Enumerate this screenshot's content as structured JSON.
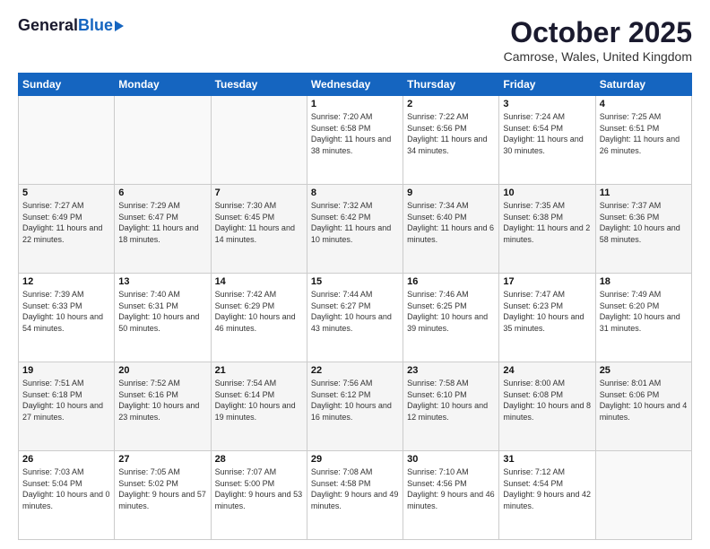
{
  "header": {
    "logo_general": "General",
    "logo_blue": "Blue",
    "title": "October 2025",
    "location": "Camrose, Wales, United Kingdom"
  },
  "days_of_week": [
    "Sunday",
    "Monday",
    "Tuesday",
    "Wednesday",
    "Thursday",
    "Friday",
    "Saturday"
  ],
  "weeks": [
    [
      {
        "day": "",
        "info": ""
      },
      {
        "day": "",
        "info": ""
      },
      {
        "day": "",
        "info": ""
      },
      {
        "day": "1",
        "info": "Sunrise: 7:20 AM\nSunset: 6:58 PM\nDaylight: 11 hours and 38 minutes."
      },
      {
        "day": "2",
        "info": "Sunrise: 7:22 AM\nSunset: 6:56 PM\nDaylight: 11 hours and 34 minutes."
      },
      {
        "day": "3",
        "info": "Sunrise: 7:24 AM\nSunset: 6:54 PM\nDaylight: 11 hours and 30 minutes."
      },
      {
        "day": "4",
        "info": "Sunrise: 7:25 AM\nSunset: 6:51 PM\nDaylight: 11 hours and 26 minutes."
      }
    ],
    [
      {
        "day": "5",
        "info": "Sunrise: 7:27 AM\nSunset: 6:49 PM\nDaylight: 11 hours and 22 minutes."
      },
      {
        "day": "6",
        "info": "Sunrise: 7:29 AM\nSunset: 6:47 PM\nDaylight: 11 hours and 18 minutes."
      },
      {
        "day": "7",
        "info": "Sunrise: 7:30 AM\nSunset: 6:45 PM\nDaylight: 11 hours and 14 minutes."
      },
      {
        "day": "8",
        "info": "Sunrise: 7:32 AM\nSunset: 6:42 PM\nDaylight: 11 hours and 10 minutes."
      },
      {
        "day": "9",
        "info": "Sunrise: 7:34 AM\nSunset: 6:40 PM\nDaylight: 11 hours and 6 minutes."
      },
      {
        "day": "10",
        "info": "Sunrise: 7:35 AM\nSunset: 6:38 PM\nDaylight: 11 hours and 2 minutes."
      },
      {
        "day": "11",
        "info": "Sunrise: 7:37 AM\nSunset: 6:36 PM\nDaylight: 10 hours and 58 minutes."
      }
    ],
    [
      {
        "day": "12",
        "info": "Sunrise: 7:39 AM\nSunset: 6:33 PM\nDaylight: 10 hours and 54 minutes."
      },
      {
        "day": "13",
        "info": "Sunrise: 7:40 AM\nSunset: 6:31 PM\nDaylight: 10 hours and 50 minutes."
      },
      {
        "day": "14",
        "info": "Sunrise: 7:42 AM\nSunset: 6:29 PM\nDaylight: 10 hours and 46 minutes."
      },
      {
        "day": "15",
        "info": "Sunrise: 7:44 AM\nSunset: 6:27 PM\nDaylight: 10 hours and 43 minutes."
      },
      {
        "day": "16",
        "info": "Sunrise: 7:46 AM\nSunset: 6:25 PM\nDaylight: 10 hours and 39 minutes."
      },
      {
        "day": "17",
        "info": "Sunrise: 7:47 AM\nSunset: 6:23 PM\nDaylight: 10 hours and 35 minutes."
      },
      {
        "day": "18",
        "info": "Sunrise: 7:49 AM\nSunset: 6:20 PM\nDaylight: 10 hours and 31 minutes."
      }
    ],
    [
      {
        "day": "19",
        "info": "Sunrise: 7:51 AM\nSunset: 6:18 PM\nDaylight: 10 hours and 27 minutes."
      },
      {
        "day": "20",
        "info": "Sunrise: 7:52 AM\nSunset: 6:16 PM\nDaylight: 10 hours and 23 minutes."
      },
      {
        "day": "21",
        "info": "Sunrise: 7:54 AM\nSunset: 6:14 PM\nDaylight: 10 hours and 19 minutes."
      },
      {
        "day": "22",
        "info": "Sunrise: 7:56 AM\nSunset: 6:12 PM\nDaylight: 10 hours and 16 minutes."
      },
      {
        "day": "23",
        "info": "Sunrise: 7:58 AM\nSunset: 6:10 PM\nDaylight: 10 hours and 12 minutes."
      },
      {
        "day": "24",
        "info": "Sunrise: 8:00 AM\nSunset: 6:08 PM\nDaylight: 10 hours and 8 minutes."
      },
      {
        "day": "25",
        "info": "Sunrise: 8:01 AM\nSunset: 6:06 PM\nDaylight: 10 hours and 4 minutes."
      }
    ],
    [
      {
        "day": "26",
        "info": "Sunrise: 7:03 AM\nSunset: 5:04 PM\nDaylight: 10 hours and 0 minutes."
      },
      {
        "day": "27",
        "info": "Sunrise: 7:05 AM\nSunset: 5:02 PM\nDaylight: 9 hours and 57 minutes."
      },
      {
        "day": "28",
        "info": "Sunrise: 7:07 AM\nSunset: 5:00 PM\nDaylight: 9 hours and 53 minutes."
      },
      {
        "day": "29",
        "info": "Sunrise: 7:08 AM\nSunset: 4:58 PM\nDaylight: 9 hours and 49 minutes."
      },
      {
        "day": "30",
        "info": "Sunrise: 7:10 AM\nSunset: 4:56 PM\nDaylight: 9 hours and 46 minutes."
      },
      {
        "day": "31",
        "info": "Sunrise: 7:12 AM\nSunset: 4:54 PM\nDaylight: 9 hours and 42 minutes."
      },
      {
        "day": "",
        "info": ""
      }
    ]
  ]
}
